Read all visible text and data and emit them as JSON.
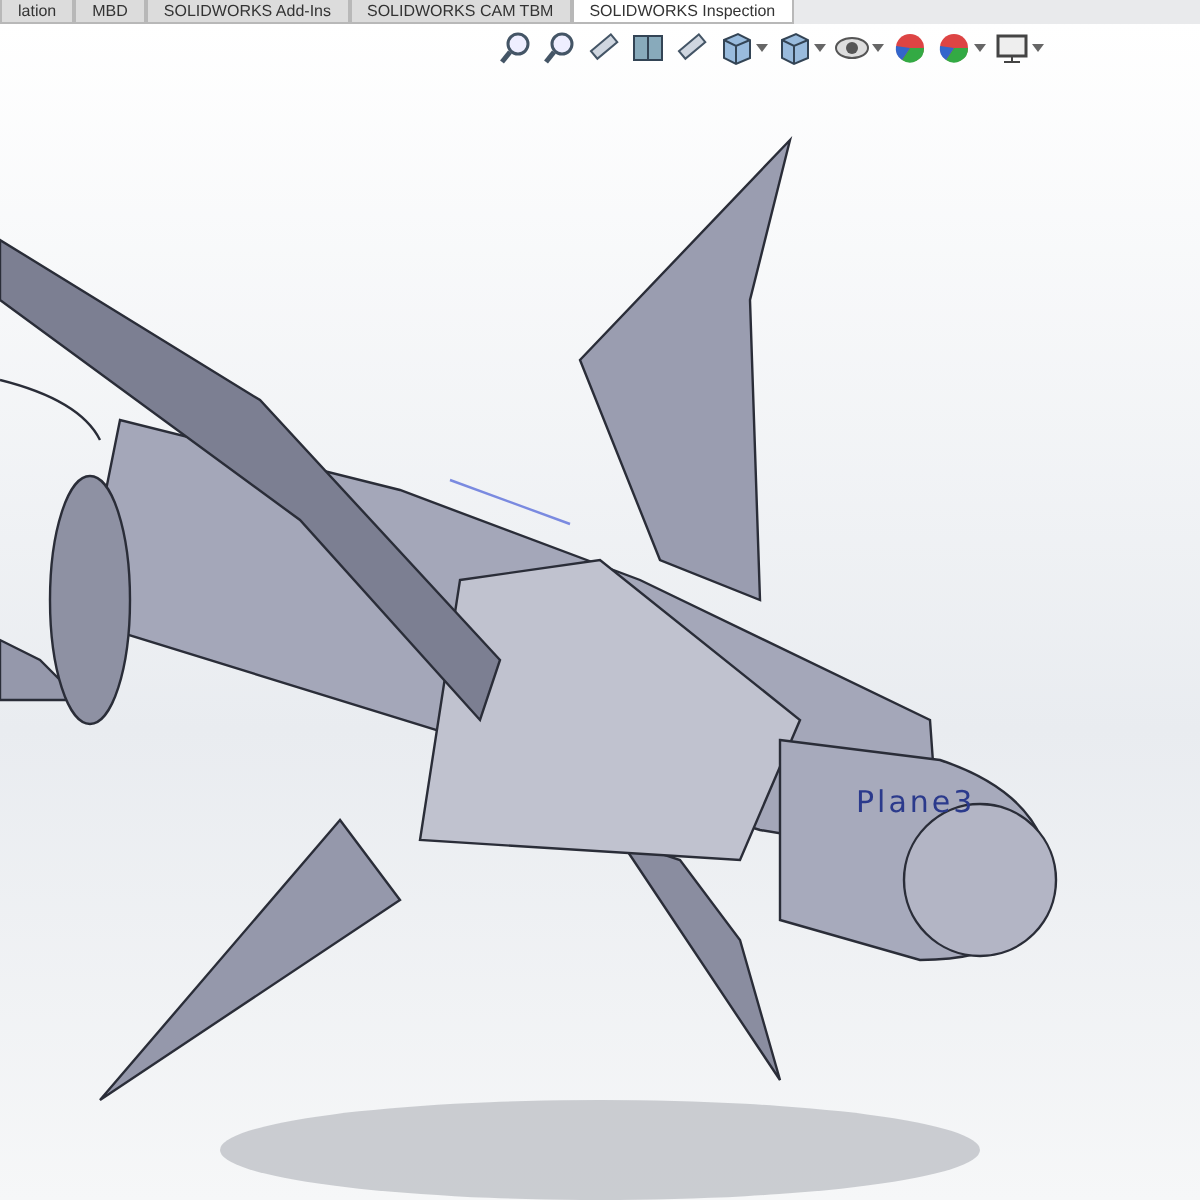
{
  "tabs": [
    {
      "label": "lation",
      "selected": false
    },
    {
      "label": "MBD",
      "selected": false
    },
    {
      "label": "SOLIDWORKS Add-Ins",
      "selected": false
    },
    {
      "label": "SOLIDWORKS CAM TBM",
      "selected": false
    },
    {
      "label": "SOLIDWORKS Inspection",
      "selected": true
    }
  ],
  "view_toolbar": [
    {
      "kind": "zoom",
      "dropdown": false
    },
    {
      "kind": "zoom",
      "dropdown": false
    },
    {
      "kind": "pen",
      "dropdown": false
    },
    {
      "kind": "section",
      "dropdown": false
    },
    {
      "kind": "pen",
      "dropdown": false
    },
    {
      "kind": "cube",
      "dropdown": true
    },
    {
      "kind": "cube",
      "dropdown": true
    },
    {
      "kind": "eye",
      "dropdown": true
    },
    {
      "kind": "ball",
      "dropdown": false
    },
    {
      "kind": "ball",
      "dropdown": true
    },
    {
      "kind": "monitor",
      "dropdown": true
    }
  ],
  "viewport": {
    "plane_label": "Plane3"
  }
}
